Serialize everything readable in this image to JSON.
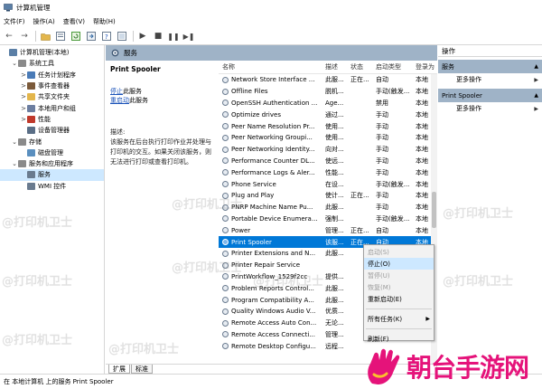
{
  "window": {
    "title": "计算机管理"
  },
  "menu": [
    "文件(F)",
    "操作(A)",
    "查看(V)",
    "帮助(H)"
  ],
  "toolbar_icons": [
    "back-icon",
    "forward-icon",
    "folder-up-icon",
    "properties-icon",
    "refresh-icon",
    "export-icon",
    "help-icon",
    "view-icon",
    "play-icon",
    "stop-icon",
    "pause-icon",
    "restart-icon"
  ],
  "tree": [
    {
      "label": "计算机管理(本地)",
      "level": 0,
      "toggle": "",
      "icon": "computer-icon",
      "color": "#5b7fa6"
    },
    {
      "label": "系统工具",
      "level": 1,
      "toggle": "⌄",
      "icon": "tools-icon",
      "color": "#8a8a8a"
    },
    {
      "label": "任务计划程序",
      "level": 2,
      "toggle": ">",
      "icon": "clock-icon",
      "color": "#4a7bb7"
    },
    {
      "label": "事件查看器",
      "level": 2,
      "toggle": ">",
      "icon": "event-icon",
      "color": "#7b5a3a"
    },
    {
      "label": "共享文件夹",
      "level": 2,
      "toggle": ">",
      "icon": "folder-icon",
      "color": "#e3b64c"
    },
    {
      "label": "本地用户和组",
      "level": 2,
      "toggle": ">",
      "icon": "users-icon",
      "color": "#6c7ea0"
    },
    {
      "label": "性能",
      "level": 2,
      "toggle": ">",
      "icon": "performance-icon",
      "color": "#c0392b"
    },
    {
      "label": "设备管理器",
      "level": 2,
      "toggle": "",
      "icon": "device-icon",
      "color": "#5a6e86"
    },
    {
      "label": "存储",
      "level": 1,
      "toggle": "⌄",
      "icon": "storage-icon",
      "color": "#8a8a8a"
    },
    {
      "label": "磁盘管理",
      "level": 2,
      "toggle": "",
      "icon": "disk-icon",
      "color": "#5a8fbf"
    },
    {
      "label": "服务和应用程序",
      "level": 1,
      "toggle": "⌄",
      "icon": "apps-icon",
      "color": "#8a8a8a"
    },
    {
      "label": "服务",
      "level": 2,
      "toggle": "",
      "icon": "services-icon",
      "color": "#6a7b8f",
      "selected": true
    },
    {
      "label": "WMI 控件",
      "level": 2,
      "toggle": "",
      "icon": "wmi-icon",
      "color": "#6a7b8f"
    }
  ],
  "center": {
    "header": "服务",
    "selected_service": "Print Spooler",
    "stop_link": "停止",
    "stop_suffix": "此服务",
    "restart_link": "重启动",
    "restart_suffix": "此服务",
    "desc_label": "描述:",
    "desc_text": "该服务在后台执行打印作业并处理与打印机的交互。如果关闭该服务，则无法进行打印或查看打印机。"
  },
  "columns": [
    "名称",
    "描述",
    "状态",
    "启动类型",
    "登录为"
  ],
  "services": [
    {
      "name": "Network Store Interface ...",
      "desc": "此服...",
      "status": "正在...",
      "start": "自动",
      "logon": "本地"
    },
    {
      "name": "Offline Files",
      "desc": "脱机...",
      "status": "",
      "start": "手动(触发...",
      "logon": "本地"
    },
    {
      "name": "OpenSSH Authentication ...",
      "desc": "Age...",
      "status": "",
      "start": "禁用",
      "logon": "本地"
    },
    {
      "name": "Optimize drives",
      "desc": "通过...",
      "status": "",
      "start": "手动",
      "logon": "本地"
    },
    {
      "name": "Peer Name Resolution Pr...",
      "desc": "使用...",
      "status": "",
      "start": "手动",
      "logon": "本地"
    },
    {
      "name": "Peer Networking Groupi...",
      "desc": "使用...",
      "status": "",
      "start": "手动",
      "logon": "本地"
    },
    {
      "name": "Peer Networking Identity...",
      "desc": "向对...",
      "status": "",
      "start": "手动",
      "logon": "本地"
    },
    {
      "name": "Performance Counter DL...",
      "desc": "使远...",
      "status": "",
      "start": "手动",
      "logon": "本地"
    },
    {
      "name": "Performance Logs & Aler...",
      "desc": "性能...",
      "status": "",
      "start": "手动",
      "logon": "本地"
    },
    {
      "name": "Phone Service",
      "desc": "在设...",
      "status": "",
      "start": "手动(触发...",
      "logon": "本地"
    },
    {
      "name": "Plug and Play",
      "desc": "使计...",
      "status": "正在...",
      "start": "手动",
      "logon": "本地"
    },
    {
      "name": "PNRP Machine Name Pu...",
      "desc": "此服...",
      "status": "",
      "start": "手动",
      "logon": "本地"
    },
    {
      "name": "Portable Device Enumera...",
      "desc": "强制...",
      "status": "",
      "start": "手动(触发...",
      "logon": "本地"
    },
    {
      "name": "Power",
      "desc": "管理...",
      "status": "正在...",
      "start": "自动",
      "logon": "本地"
    },
    {
      "name": "Print Spooler",
      "desc": "该服...",
      "status": "正在...",
      "start": "自动",
      "logon": "本地",
      "selected": true
    },
    {
      "name": "Printer Extensions and N...",
      "desc": "此服...",
      "status": "",
      "start": "",
      "logon": ""
    },
    {
      "name": "Printer Repair Service",
      "desc": "",
      "status": "",
      "start": "",
      "logon": ""
    },
    {
      "name": "PrintWorkflow_1529f2cc",
      "desc": "提供...",
      "status": "",
      "start": "",
      "logon": ""
    },
    {
      "name": "Problem Reports Control...",
      "desc": "此服...",
      "status": "",
      "start": "",
      "logon": ""
    },
    {
      "name": "Program Compatibility A...",
      "desc": "此服...",
      "status": "",
      "start": "",
      "logon": ""
    },
    {
      "name": "Quality Windows Audio V...",
      "desc": "优质...",
      "status": "",
      "start": "",
      "logon": ""
    },
    {
      "name": "Remote Access Auto Con...",
      "desc": "无论...",
      "status": "",
      "start": "",
      "logon": ""
    },
    {
      "name": "Remote Access Connecti...",
      "desc": "管理...",
      "status": "",
      "start": "",
      "logon": ""
    },
    {
      "name": "Remote Desktop Configu...",
      "desc": "远程...",
      "status": "",
      "start": "",
      "logon": ""
    }
  ],
  "tabs": [
    "扩展",
    "标准"
  ],
  "actions": {
    "title": "操作",
    "sections": [
      {
        "label": "服务",
        "more": "更多操作"
      },
      {
        "label": "Print Spooler",
        "more": "更多操作"
      }
    ]
  },
  "context_menu": [
    {
      "label": "启动(S)",
      "state": "disabled"
    },
    {
      "label": "停止(O)",
      "state": "highlighted"
    },
    {
      "label": "暂停(U)",
      "state": "disabled"
    },
    {
      "label": "恢复(M)",
      "state": "disabled"
    },
    {
      "label": "重新启动(E)",
      "state": "normal"
    },
    {
      "sep": true
    },
    {
      "label": "所有任务(K)",
      "state": "normal",
      "submenu": true
    },
    {
      "sep": true
    },
    {
      "label": "刷新(F)",
      "state": "normal"
    }
  ],
  "status_text": "在 本地计算机 上的服务 Print Spooler",
  "watermark": "@打印机卫士",
  "brand": "朝台手游网",
  "colors": {
    "selection": "#0078d7",
    "pane_header": "#9fb3c7",
    "brand": "#e5137a",
    "link": "#1a52b8"
  }
}
